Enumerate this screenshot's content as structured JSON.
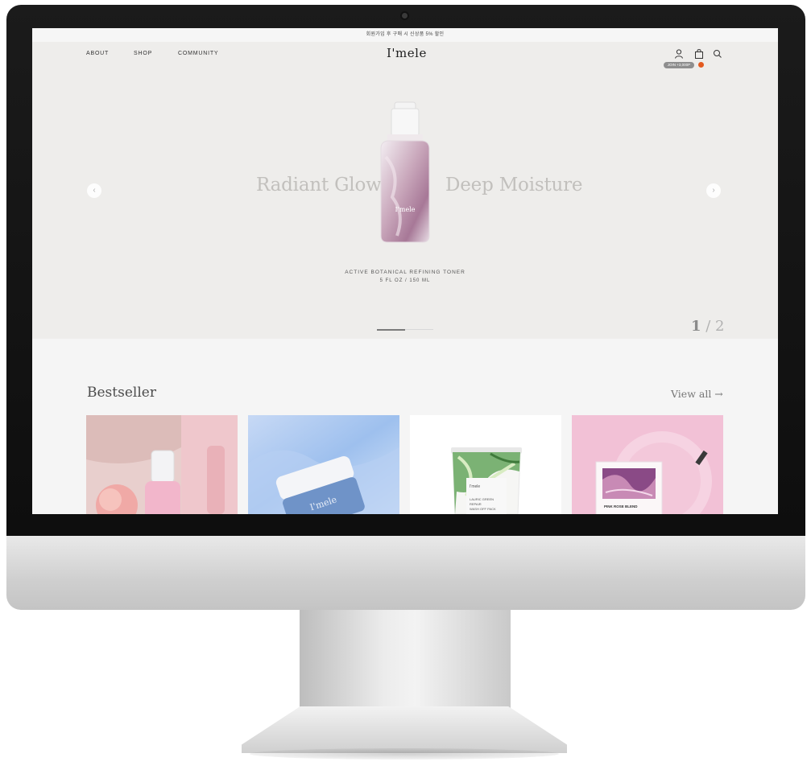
{
  "topbar": {
    "notice": "회원가입 후 구매 시 신상품 5% 할인"
  },
  "nav": {
    "about": "ABOUT",
    "shop": "SHOP",
    "community": "COMMUNITY",
    "logo": "I'mele",
    "reward_pill": "JOIN +3,000P",
    "icons": [
      "user-icon",
      "cart-icon",
      "search-icon"
    ]
  },
  "hero": {
    "left_text": "Radiant Glow",
    "right_text": "Deep Moisture",
    "product_label": "I'mele",
    "product_name": "ACTIVE BOTANICAL REFINING TONER",
    "product_size": "5 FL OZ / 150 ML",
    "page_current": "1",
    "page_separator": " / ",
    "page_total": "2",
    "slider_progress": 0.5
  },
  "bestseller": {
    "title": "Bestseller",
    "view_all": "View all →",
    "products": [
      {
        "label": ""
      },
      {
        "label": "I'mele"
      },
      {
        "label": "I'mele",
        "sublabel_1": "LAURIC GREEN",
        "sublabel_2": "REPAIR",
        "sublabel_3": "WASH OFF PACK"
      },
      {
        "label": "PINK ROSE BLEND"
      }
    ]
  },
  "colors": {
    "screen_bg": "#eeedeb",
    "section_bg": "#f5f5f5",
    "accent_badge": "#e35a1f"
  }
}
